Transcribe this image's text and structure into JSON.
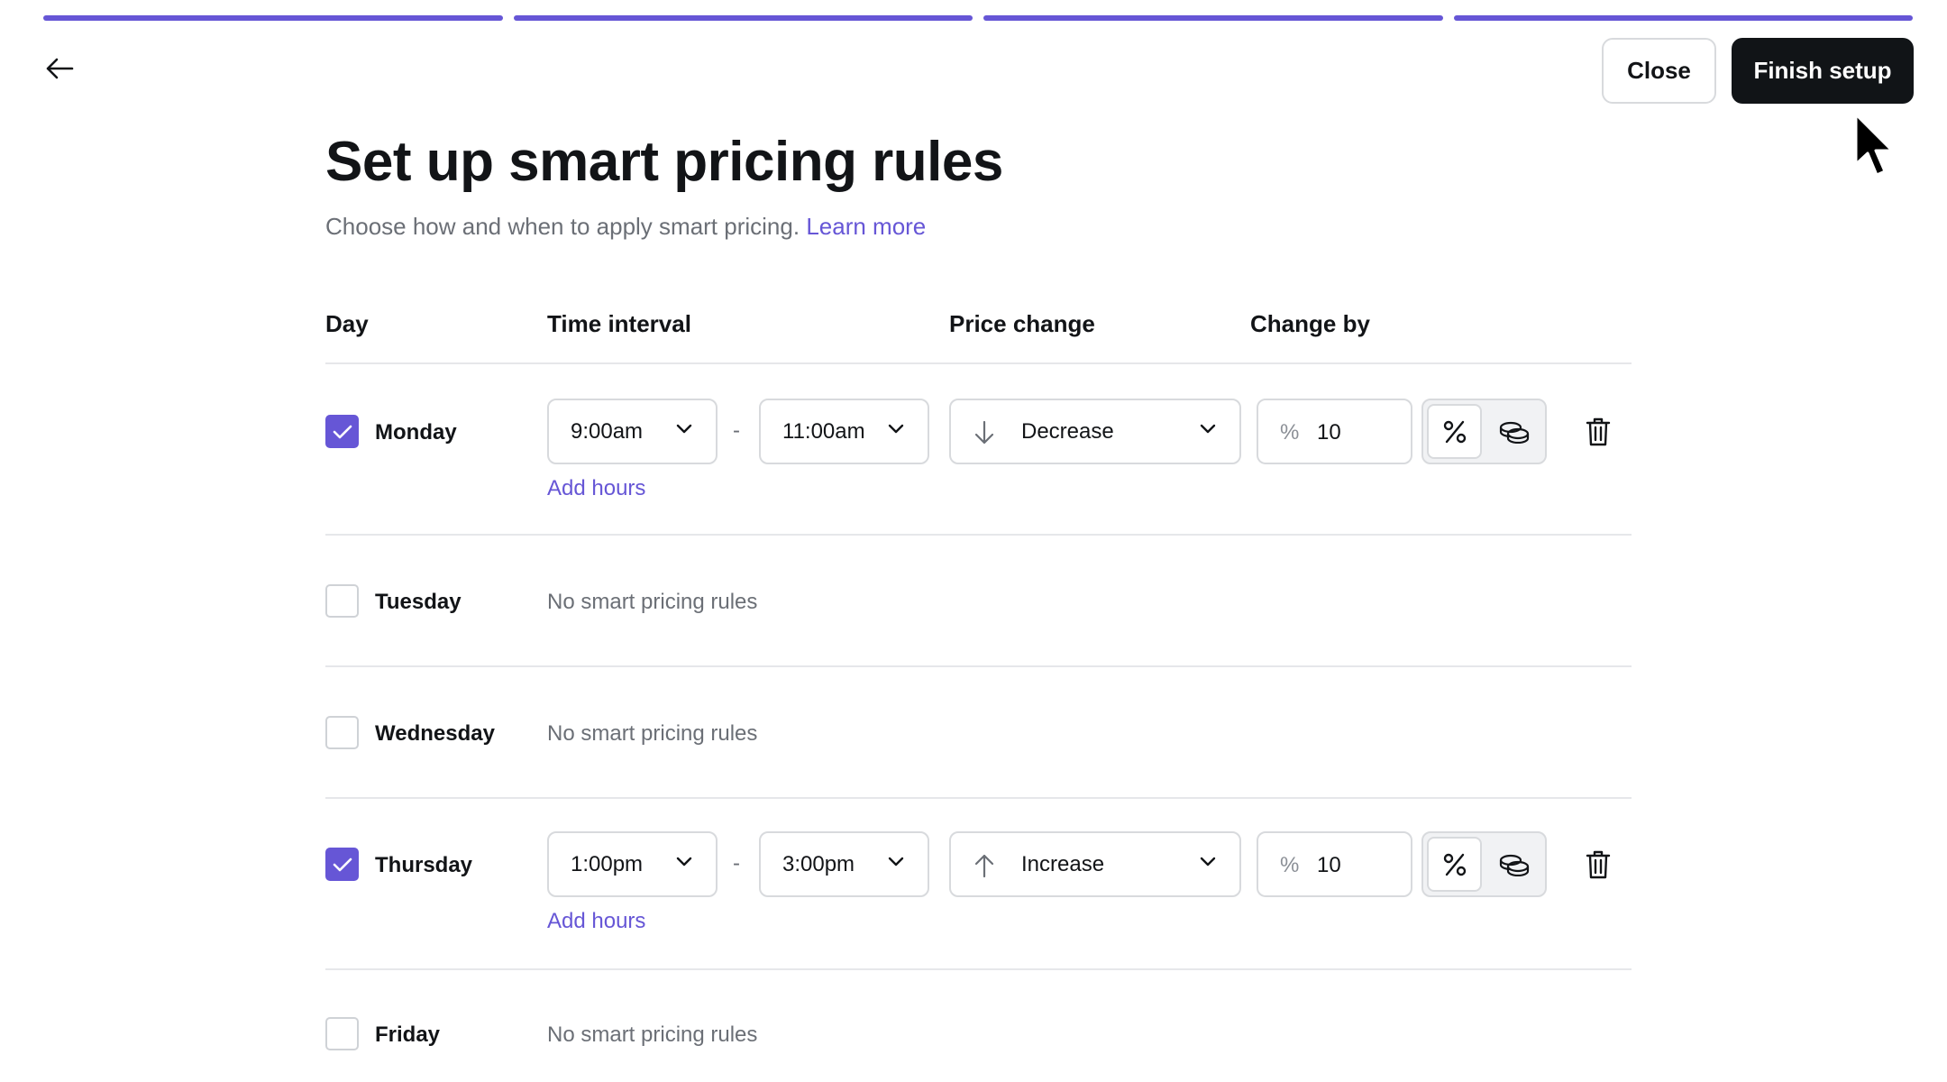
{
  "progress": {
    "segments": 4,
    "completed": 4,
    "color": "#6656d6"
  },
  "header": {
    "back_icon": "arrow-left-icon",
    "close_label": "Close",
    "finish_label": "Finish setup"
  },
  "page": {
    "title": "Set up smart pricing rules",
    "subtitle": "Choose how and when to apply smart pricing.",
    "learn_more": "Learn more"
  },
  "table": {
    "headers": {
      "day": "Day",
      "time_interval": "Time interval",
      "price_change": "Price change",
      "change_by": "Change by"
    },
    "rows": [
      {
        "day": "Monday",
        "checked": true,
        "start": "9:00am",
        "end": "11:00am",
        "direction": "Decrease",
        "direction_icon": "arrow-down-icon",
        "unit_symbol": "%",
        "amount": "10",
        "add_hours": "Add hours"
      },
      {
        "day": "Tuesday",
        "checked": false,
        "empty": "No smart pricing rules"
      },
      {
        "day": "Wednesday",
        "checked": false,
        "empty": "No smart pricing rules"
      },
      {
        "day": "Thursday",
        "checked": true,
        "start": "1:00pm",
        "end": "3:00pm",
        "direction": "Increase",
        "direction_icon": "arrow-up-icon",
        "unit_symbol": "%",
        "amount": "10",
        "add_hours": "Add hours"
      },
      {
        "day": "Friday",
        "checked": false,
        "empty": "No smart pricing rules"
      }
    ],
    "range_separator": "-"
  },
  "colors": {
    "accent": "#6656d6",
    "primary_button": "#111417",
    "muted_text": "#6b6f76"
  }
}
